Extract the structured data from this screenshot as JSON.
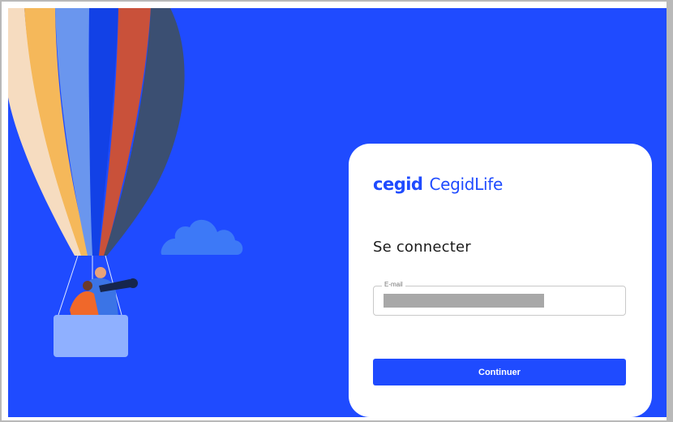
{
  "brand": {
    "logo_text": "cegid",
    "product_name": "CegidLife",
    "accent_color": "#1f4bff"
  },
  "login": {
    "title": "Se connecter",
    "email_label": "E-mail",
    "email_value": "",
    "continue_label": "Continuer"
  },
  "illustration": {
    "subject": "hot-air-balloon",
    "cloud": "cloud-icon"
  }
}
